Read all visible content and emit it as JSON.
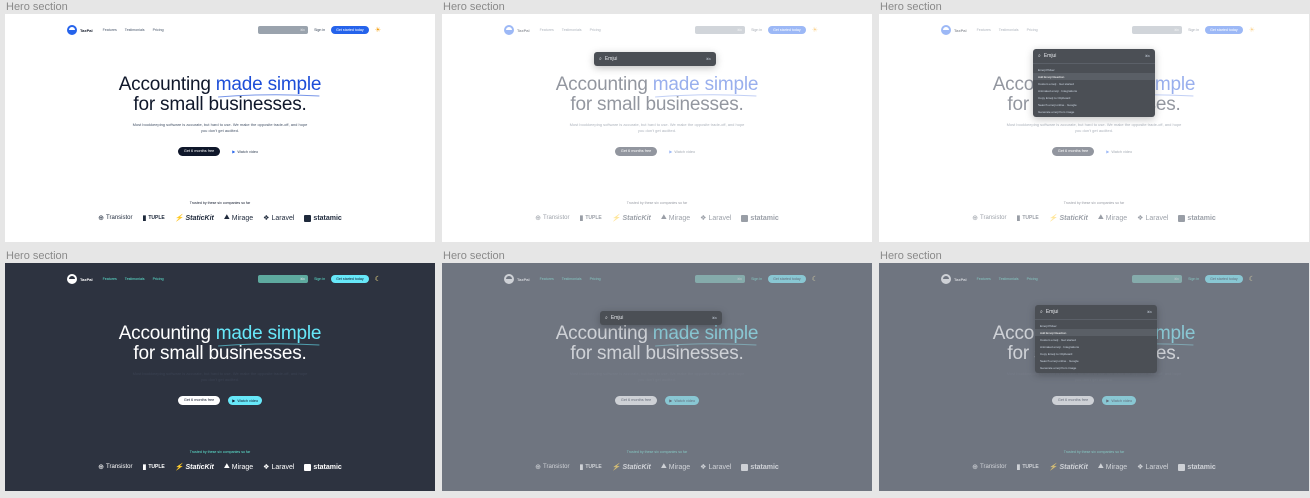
{
  "cells": [
    {
      "label": "Hero section",
      "theme": "light",
      "state": "default"
    },
    {
      "label": "Hero section",
      "theme": "light",
      "state": "search"
    },
    {
      "label": "Hero section",
      "theme": "light",
      "state": "results"
    },
    {
      "label": "Hero section",
      "theme": "dark",
      "state": "default"
    },
    {
      "label": "Hero section",
      "theme": "dark",
      "state": "search"
    },
    {
      "label": "Hero section",
      "theme": "dark",
      "state": "results"
    }
  ],
  "nav": {
    "logo": "TaxPal",
    "links": [
      "Features",
      "Testimonials",
      "Pricing"
    ],
    "search_kbd": "⌘K",
    "sign_in": "Sign in",
    "cta": "Get started today"
  },
  "hero": {
    "headline_pre": "Accounting ",
    "headline_accent": "made simple",
    "headline_post": "for small businesses.",
    "sub": "Most bookkeeping software is accurate, but hard to use. We make the opposite trade-off, and hope you don't get audited.",
    "primary": "Get 6 months free",
    "secondary": "Watch video"
  },
  "trusted": "Trusted by these six companies so far",
  "companies": [
    "Transistor",
    "TUPLE",
    "StaticKit",
    "Mirage",
    "Laravel",
    "statamic"
  ],
  "palette": {
    "query": "Emjui",
    "kbd": "⌘K",
    "items": [
      "Emoji Picker",
      "Add Emoji Reaction",
      "Custom emoji · Get started",
      "Animated emoji · Integrations",
      "Copy Emoji to Clipboard",
      "Search emoji online · Google",
      "Generate emoji from image"
    ]
  },
  "colors": {
    "accent_light": "#2563eb",
    "accent_dark": "#67e8f9",
    "dark_bg": "#2d3340"
  }
}
